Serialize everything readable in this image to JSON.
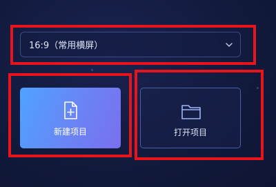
{
  "aspect_select": {
    "value": "16:9（常用横屏）",
    "icon": "chevron-down-icon"
  },
  "new_project": {
    "label": "新建项目",
    "icon": "new-file-icon"
  },
  "open_project": {
    "label": "打开项目",
    "icon": "folder-icon"
  },
  "colors": {
    "highlight": "#e8141b",
    "new_gradient_start": "#4fa3ff",
    "new_gradient_end": "#7a6ff0",
    "background": "#121a3d"
  }
}
